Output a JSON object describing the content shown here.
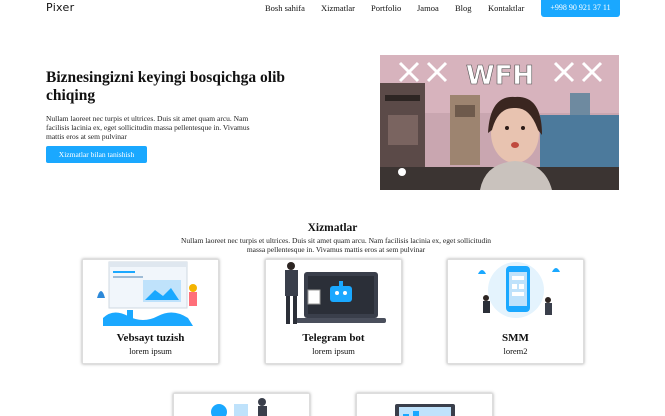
{
  "brand": {
    "logo": "Pixer",
    "accent": "#1aa8ff"
  },
  "nav": {
    "items": [
      "Bosh sahifa",
      "Xizmatlar",
      "Portfolio",
      "Jamoa",
      "Blog",
      "Kontaktlar"
    ],
    "phone": "+998 90 921 37 11"
  },
  "hero": {
    "title": "Biznesingizni keyingi bosqichga olib chiqing",
    "text": "Nullam laoreet nec turpis et ultrices. Duis sit amet quam arcu. Nam facilisis lacinia ex, eget sollicitudin massa pellentesque in. Vivamus mattis eros at sem pulvinar",
    "button": "Xizmatlar bilan tanishish",
    "media_caption": "WFH"
  },
  "services": {
    "title": "Xizmatlar",
    "text": "Nullam laoreet nec turpis et ultrices. Duis sit amet quam arcu. Nam facilisis lacinia ex, eget sollicitudin massa pellentesque in. Vivamus mattis eros at sem pulvinar",
    "cards": [
      {
        "title": "Vebsayt tuzish",
        "subtitle": "lorem ipsum",
        "icon": "website-illustration"
      },
      {
        "title": "Telegram bot",
        "subtitle": "lorem ipsum",
        "icon": "bot-illustration"
      },
      {
        "title": "SMM",
        "subtitle": "lorem2",
        "icon": "smm-illustration"
      }
    ]
  }
}
